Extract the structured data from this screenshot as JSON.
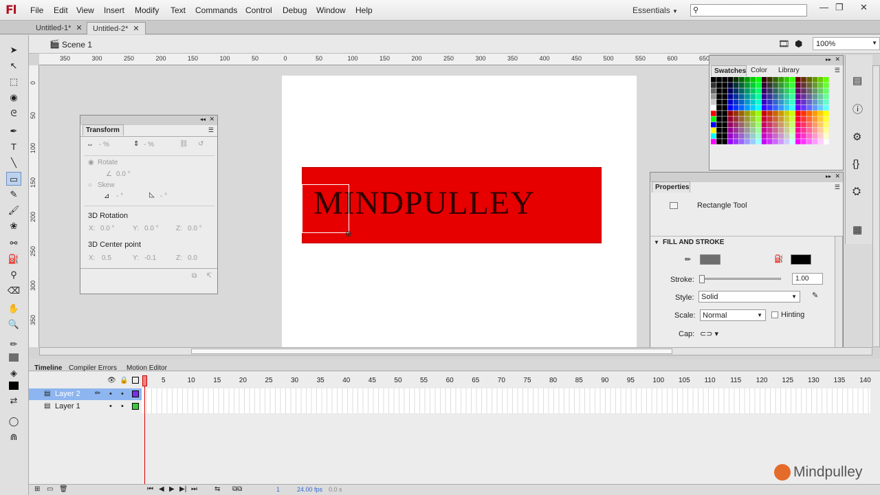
{
  "menubar": {
    "logo": "Fl",
    "menus": [
      "File",
      "Edit",
      "View",
      "Insert",
      "Modify",
      "Text",
      "Commands",
      "Control",
      "Debug",
      "Window",
      "Help"
    ],
    "workspace": "Essentials",
    "search_placeholder": ""
  },
  "tabs": [
    {
      "label": "Untitled-1*"
    },
    {
      "label": "Untitled-2*"
    }
  ],
  "scene": {
    "label": "Scene 1",
    "zoom": "100%"
  },
  "ruler": {
    "h_ticks": [
      "350",
      "300",
      "250",
      "200",
      "150",
      "100",
      "50",
      "0",
      "50",
      "100",
      "150",
      "200",
      "250",
      "300",
      "350",
      "400",
      "450",
      "500",
      "550",
      "600",
      "650",
      "700"
    ],
    "v_ticks": [
      "0",
      "50",
      "100",
      "150",
      "200",
      "250",
      "300",
      "350"
    ]
  },
  "stage": {
    "text": "MINDPULLEY",
    "rect_color": "#e60000"
  },
  "transform_panel": {
    "title": "Transform",
    "width_pct": "- %",
    "height_pct": "- %",
    "rotate_label": "Rotate",
    "rotate_value": "0.0 °",
    "skew_label": "Skew",
    "skew_h": "- °",
    "skew_v": "- °",
    "rotation_3d": "3D Rotation",
    "rot_x": "X:",
    "rot_x_val": "0.0 °",
    "rot_y": "Y:",
    "rot_y_val": "0.0 °",
    "rot_z": "Z:",
    "rot_z_val": "0.0 °",
    "center_3d": "3D Center point",
    "c_x": "X:",
    "c_x_val": "0.5",
    "c_y": "Y:",
    "c_y_val": "-0.1",
    "c_z": "Z:",
    "c_z_val": "0.0"
  },
  "swatches_panel": {
    "tabs": [
      "Swatches",
      "Color",
      "Library"
    ]
  },
  "properties_panel": {
    "title": "Properties",
    "tool_name": "Rectangle Tool",
    "section": "FILL AND STROKE",
    "stroke_label": "Stroke:",
    "stroke_value": "1.00",
    "style_label": "Style:",
    "style_value": "Solid",
    "scale_label": "Scale:",
    "scale_value": "Normal",
    "hinting_label": "Hinting",
    "cap_label": "Cap:",
    "fill_color": "#6e6e6e",
    "stroke_color": "#000000"
  },
  "timeline": {
    "tabs": [
      "Timeline",
      "Compiler Errors",
      "Motion Editor"
    ],
    "frame_numbers": [
      "5",
      "10",
      "15",
      "20",
      "25",
      "30",
      "35",
      "40",
      "45",
      "50",
      "55",
      "60",
      "65",
      "70",
      "75",
      "80",
      "85",
      "90",
      "95",
      "100",
      "105",
      "110",
      "115",
      "120",
      "125",
      "130",
      "135",
      "140"
    ],
    "layers": [
      {
        "name": "Layer 2",
        "color": "#7b2ee6"
      },
      {
        "name": "Layer 1",
        "color": "#3cc83c"
      }
    ],
    "status_frame": "1",
    "status_fps": "24.00 fps",
    "status_time": "0.0 s"
  },
  "watermark": "Mindpulley"
}
